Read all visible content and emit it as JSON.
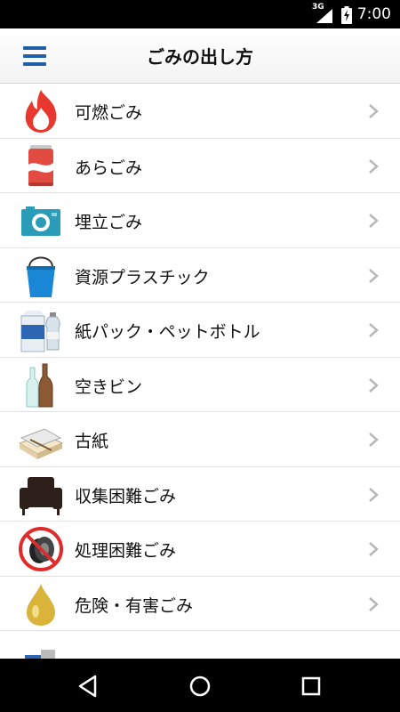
{
  "status_bar": {
    "network": "3G",
    "time": "7:00"
  },
  "app_bar": {
    "title": "ごみの出し方"
  },
  "list": {
    "items": [
      {
        "label": "可燃ごみ",
        "icon": "flame-icon"
      },
      {
        "label": "あらごみ",
        "icon": "can-icon"
      },
      {
        "label": "埋立ごみ",
        "icon": "camera-icon"
      },
      {
        "label": "資源プラスチック",
        "icon": "bucket-icon"
      },
      {
        "label": "紙パック・ペットボトル",
        "icon": "milk-carton-bottle-icon"
      },
      {
        "label": "空きビン",
        "icon": "glass-bottles-icon"
      },
      {
        "label": "古紙",
        "icon": "newspaper-bundle-icon"
      },
      {
        "label": "収集困難ごみ",
        "icon": "armchair-icon"
      },
      {
        "label": "処理困難ごみ",
        "icon": "no-tire-icon"
      },
      {
        "label": "危険・有害ごみ",
        "icon": "oil-drop-icon"
      }
    ]
  },
  "colors": {
    "accent": "#1f5fa8",
    "status_bar": "#000000",
    "nav_bar": "#000000",
    "flame": "#e8372e",
    "can": "#e14b42",
    "camera": "#2a9cb8",
    "bucket": "#1a87d6",
    "oil": "#d9b33a"
  }
}
